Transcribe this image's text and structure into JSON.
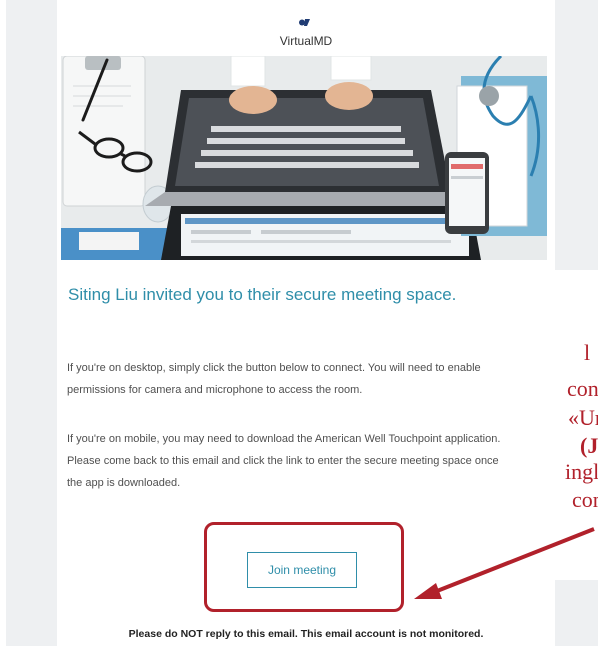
{
  "header": {
    "logo_text": "",
    "brand": "VirtualMD"
  },
  "message": {
    "headline": "Siting Liu invited you to their secure meeting space.",
    "paragraph_desktop": "If you're on desktop, simply click the button below to connect. You will need to enable permissions for camera and microphone to access the room.",
    "paragraph_mobile": "If you're on mobile, you may need to download the American Well Touchpoint application. Please come back to this email and click the link to enter the secure meeting space once the app is downloaded.",
    "join_label": "Join meeting",
    "footer": "Please do NOT reply to this email. This email account is not monitored."
  },
  "annotation": {
    "line1": "l",
    "line2": "con",
    "line3": "«Ur",
    "line4": "(J",
    "line5": "inglé",
    "line6": "con"
  },
  "colors": {
    "accent": "#2f8ea9",
    "highlight": "#b1212b",
    "side_background": "#eef0f2"
  }
}
